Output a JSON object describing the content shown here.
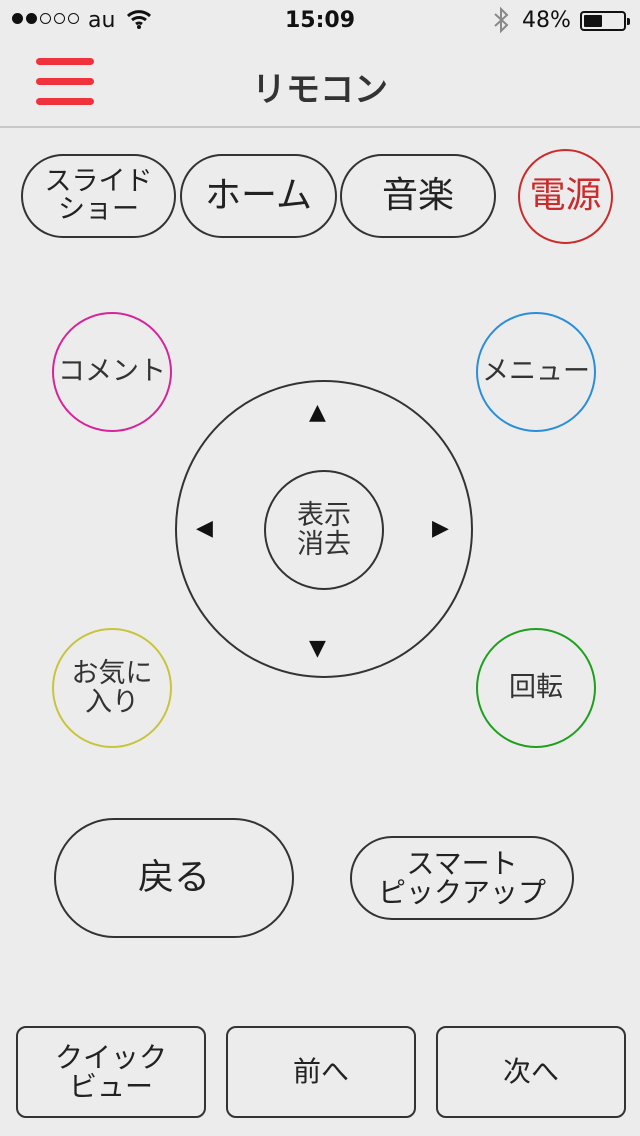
{
  "status_bar": {
    "carrier": "au",
    "time": "15:09",
    "battery_percent": "48%",
    "battery_level": 0.48,
    "signal_bars_filled": 2,
    "signal_bars_total": 5
  },
  "nav": {
    "title": "リモコン",
    "menu_icon": "hamburger-icon",
    "menu_color": "#f0323c"
  },
  "top_buttons": {
    "slideshow": "スライド\nショー",
    "home": "ホーム",
    "music": "音楽",
    "power": "電源"
  },
  "circle_buttons": {
    "comment": "コメント",
    "menu": "メニュー",
    "favorite": "お気に\n入り",
    "rotate": "回転"
  },
  "dpad": {
    "center": "表示\n消去",
    "up_icon": "▲",
    "down_icon": "▼",
    "left_icon": "◀",
    "right_icon": "▶"
  },
  "action_buttons": {
    "back": "戻る",
    "smart_pickup": "スマート\nピックアップ"
  },
  "bottom_buttons": {
    "quick_view": "クイック\nビュー",
    "prev": "前へ",
    "next": "次へ"
  },
  "colors": {
    "power": "#cc2b2b",
    "comment": "#d6259a",
    "menu": "#2a8fd8",
    "favorite": "#c9c43d",
    "rotate": "#1ea01e",
    "background": "#ececec"
  }
}
